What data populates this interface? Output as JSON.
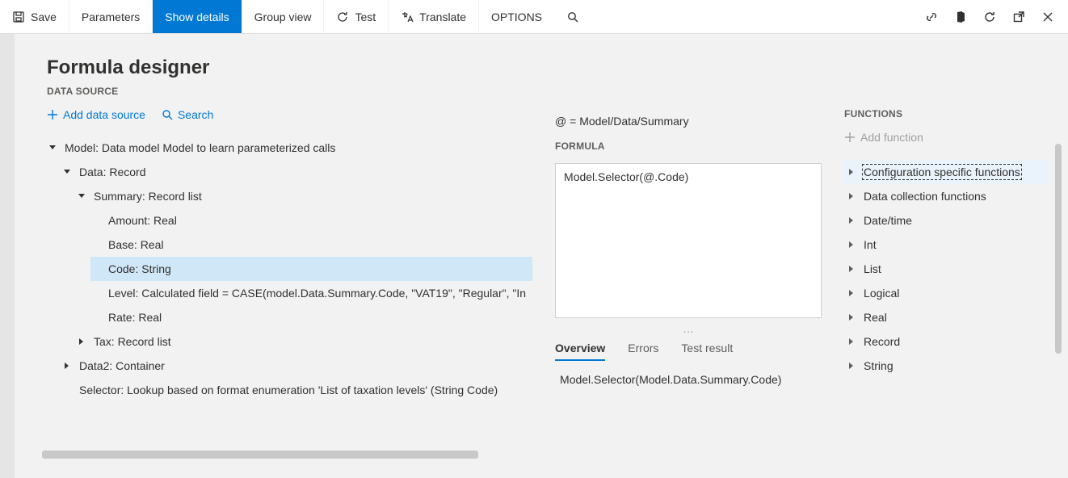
{
  "toolbar": {
    "save": "Save",
    "parameters": "Parameters",
    "show_details": "Show details",
    "group_view": "Group view",
    "test": "Test",
    "translate": "Translate",
    "options": "OPTIONS"
  },
  "page": {
    "title": "Formula designer"
  },
  "data_source": {
    "label": "DATA SOURCE",
    "add": "Add data source",
    "search": "Search",
    "tree": {
      "model": "Model: Data model Model to learn parameterized calls",
      "data": "Data: Record",
      "summary": "Summary: Record list",
      "amount": "Amount: Real",
      "base": "Base: Real",
      "code": "Code: String",
      "level": "Level: Calculated field = CASE(model.Data.Summary.Code, \"VAT19\", \"Regular\", \"In",
      "rate": "Rate: Real",
      "tax": "Tax: Record list",
      "data2": "Data2: Container",
      "selector": "Selector: Lookup based on format enumeration 'List of taxation levels' (String Code)"
    }
  },
  "formula": {
    "binding_label": "@ = Model/Data/Summary",
    "label": "FORMULA",
    "text": "Model.Selector(@.Code)",
    "ellipsis": "…",
    "tabs": {
      "overview": "Overview",
      "errors": "Errors",
      "test_result": "Test result"
    },
    "resolved": "Model.Selector(Model.Data.Summary.Code)"
  },
  "functions": {
    "label": "FUNCTIONS",
    "add": "Add function",
    "items": [
      "Configuration specific functions",
      "Data collection functions",
      "Date/time",
      "Int",
      "List",
      "Logical",
      "Real",
      "Record",
      "String"
    ]
  }
}
